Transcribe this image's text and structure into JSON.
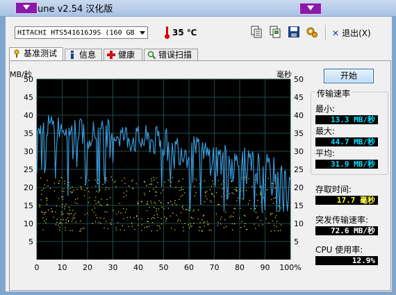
{
  "window": {
    "title": "une v2.54 汉化版"
  },
  "toolbar": {
    "drive": "HITACHI HTS541616J9S (160 GB",
    "temperature": "35 ℃",
    "exit_label": "退出(X)"
  },
  "tabs": [
    {
      "label": "基准测试",
      "icon": "benchmark-icon"
    },
    {
      "label": "信息",
      "icon": "info-icon"
    },
    {
      "label": "健康",
      "icon": "health-icon"
    },
    {
      "label": "错误扫描",
      "icon": "magnifier-icon"
    }
  ],
  "benchmark": {
    "start_label": "开始",
    "transfer_rate_title": "传输速率",
    "min_label": "最小:",
    "min_value": "13.3 MB/秒",
    "max_label": "最大:",
    "max_value": "44.7 MB/秒",
    "avg_label": "平均:",
    "avg_value": "31.9 MB/秒",
    "access_time_label": "存取时间:",
    "access_time_value": "17.7 毫秒",
    "burst_rate_label": "突发传输速率:",
    "burst_rate_value": "72.6 MB/秒",
    "cpu_label": "CPU 使用率:",
    "cpu_value": "12.9%"
  },
  "chart_data": {
    "type": "line",
    "left_axis_label": "MB/秒",
    "right_axis_label": "毫秒",
    "y_ticks": [
      "50",
      "45",
      "40",
      "35",
      "30",
      "25",
      "20",
      "15",
      "10",
      "5"
    ],
    "y_range": [
      0,
      50
    ],
    "x_ticks": [
      "0",
      "10",
      "20",
      "30",
      "40",
      "50",
      "60",
      "70",
      "80",
      "90",
      "100%"
    ],
    "x_range": [
      0,
      100
    ],
    "grid": true,
    "series": [
      {
        "color": "#3a9ad8",
        "x": [
          0,
          5,
          10,
          15,
          20,
          25,
          30,
          35,
          40,
          45,
          50,
          55,
          60,
          65,
          70,
          75,
          80,
          85,
          90,
          95,
          100
        ],
        "values": [
          36,
          37,
          37,
          36,
          35,
          35,
          35,
          34,
          33,
          33,
          32,
          31,
          30,
          29,
          28,
          27,
          26,
          25,
          24,
          22,
          20
        ]
      }
    ],
    "access_time_points": {
      "color": "#ffff40",
      "range_ms": [
        8,
        23
      ]
    }
  },
  "colors": {
    "chart_bg": "#000000",
    "grid": "#1f4a4a",
    "transfer_line": "#3a9ad8",
    "access_dots": "#ffff40",
    "title_icon": "#8a1aa8"
  }
}
